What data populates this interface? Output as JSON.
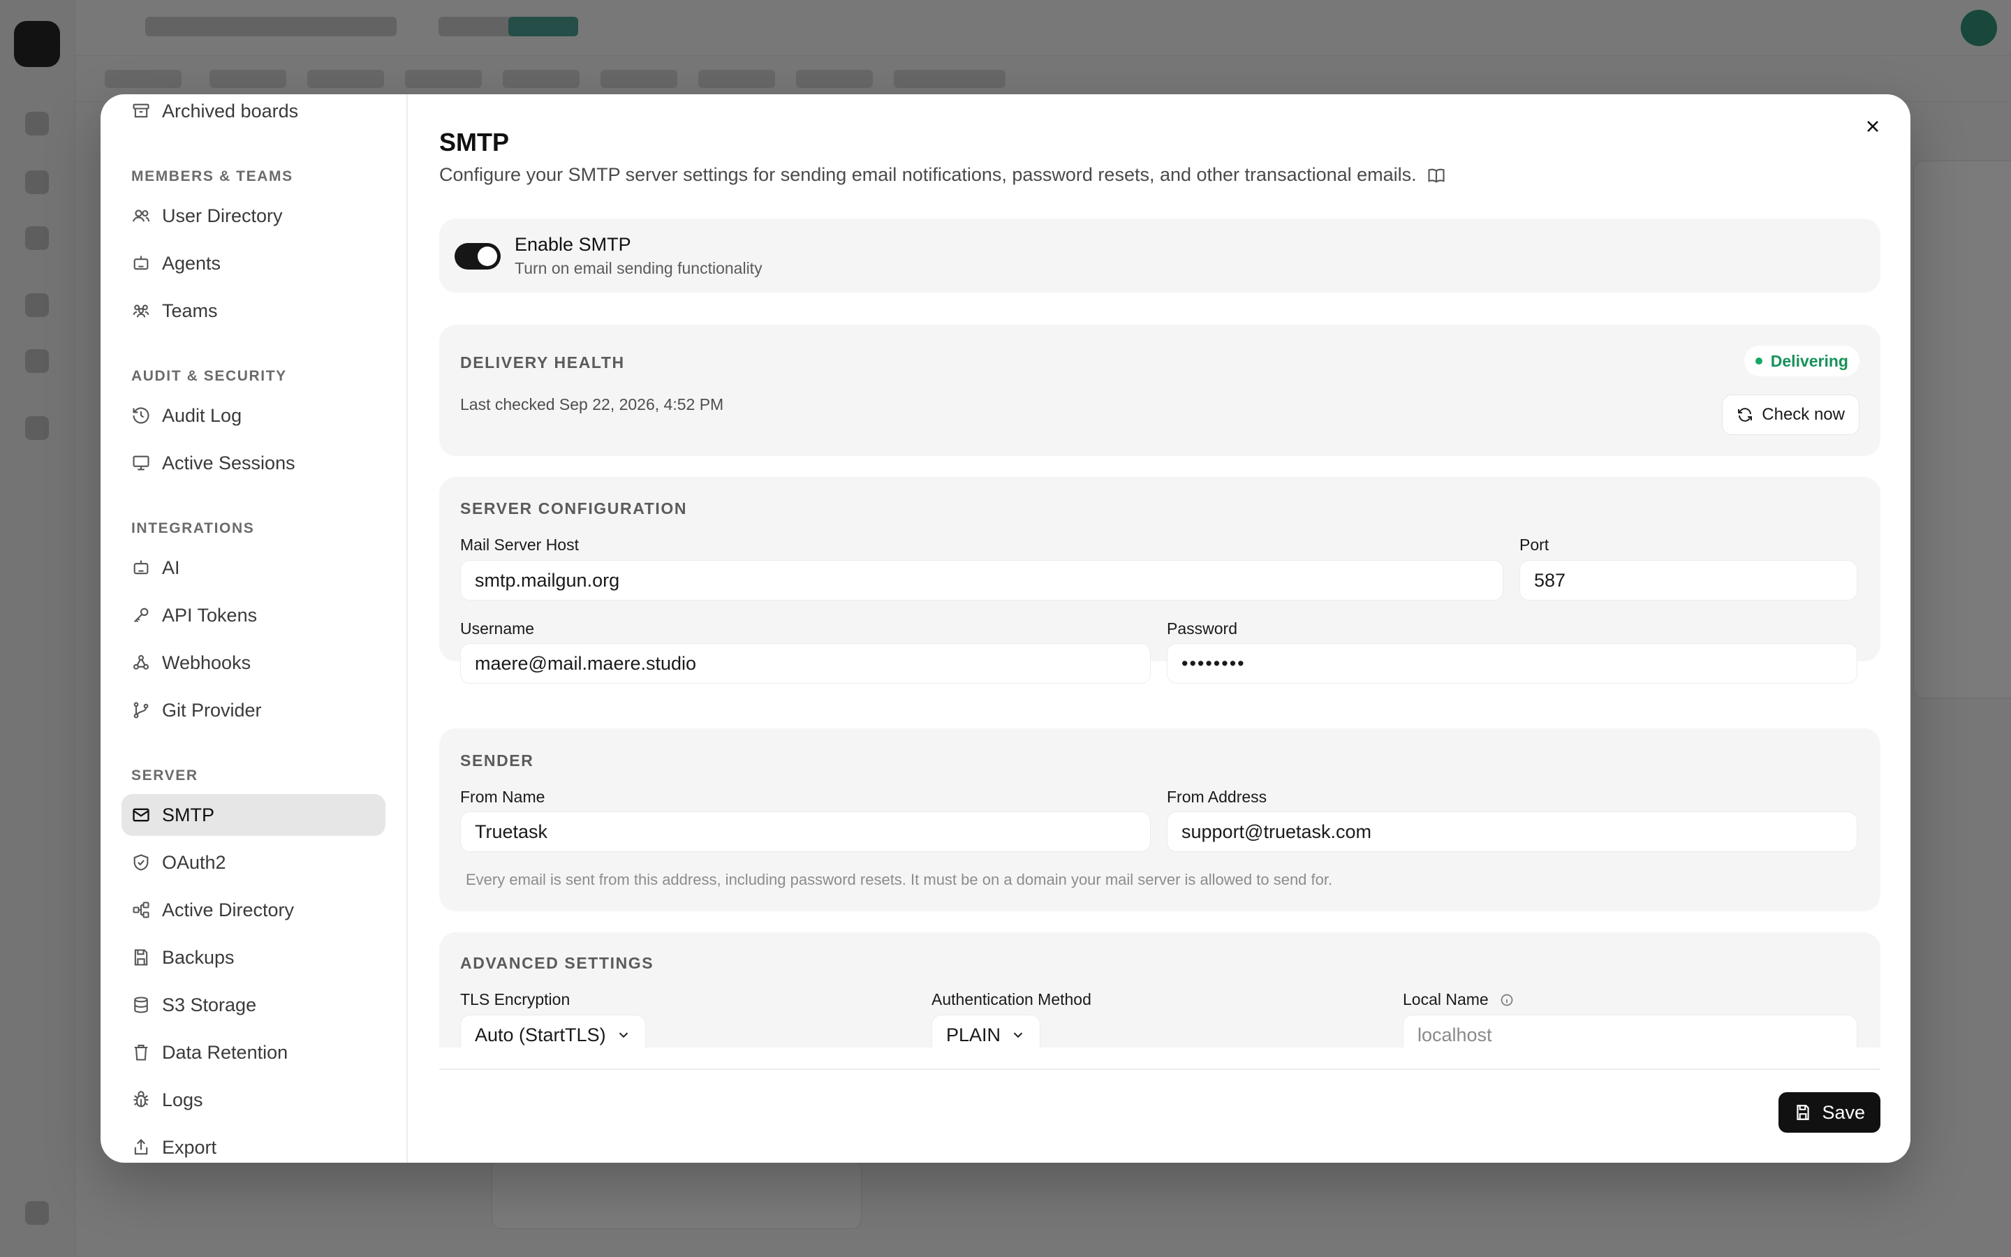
{
  "nav": {
    "archived_boards": "Archived boards",
    "sections": {
      "members_teams": "MEMBERS & TEAMS",
      "audit_security": "AUDIT & SECURITY",
      "integrations": "INTEGRATIONS",
      "server": "SERVER"
    },
    "members_teams": [
      "User Directory",
      "Agents",
      "Teams"
    ],
    "audit_security": [
      "Audit Log",
      "Active Sessions"
    ],
    "integrations": [
      "AI",
      "API Tokens",
      "Webhooks",
      "Git Provider"
    ],
    "server": [
      "SMTP",
      "OAuth2",
      "Active Directory",
      "Backups",
      "S3 Storage",
      "Data Retention",
      "Logs",
      "Export"
    ],
    "active_item": "SMTP"
  },
  "page": {
    "title": "SMTP",
    "subtitle": "Configure your SMTP server settings for sending email notifications, password resets, and other transactional emails."
  },
  "enable": {
    "label": "Enable SMTP",
    "description": "Turn on email sending functionality",
    "enabled": true
  },
  "health": {
    "title": "DELIVERY HEALTH",
    "last_checked": "Last checked Sep 22, 2026, 4:52 PM",
    "status": "Delivering",
    "check_label": "Check now"
  },
  "server": {
    "title": "SERVER CONFIGURATION",
    "host_label": "Mail Server Host",
    "host_value": "smtp.mailgun.org",
    "port_label": "Port",
    "port_value": "587",
    "username_label": "Username",
    "username_value": "maere@mail.maere.studio",
    "password_label": "Password",
    "password_value": "••••••••"
  },
  "sender": {
    "title": "SENDER",
    "from_name_label": "From Name",
    "from_name_value": "Truetask",
    "from_address_label": "From Address",
    "from_address_value": "support@truetask.com",
    "help": "Every email is sent from this address, including password resets. It must be on a domain your mail server is allowed to send for."
  },
  "advanced": {
    "title": "ADVANCED SETTINGS",
    "tls_label": "TLS Encryption",
    "tls_value": "Auto (StartTLS)",
    "auth_label": "Authentication Method",
    "auth_value": "PLAIN",
    "local_name_label": "Local Name",
    "local_name_placeholder": "localhost"
  },
  "footer": {
    "save_label": "Save"
  },
  "colors": {
    "accent": "#111111",
    "status_green": "#16915a",
    "overlay": "rgba(20,20,20,0.56)"
  }
}
